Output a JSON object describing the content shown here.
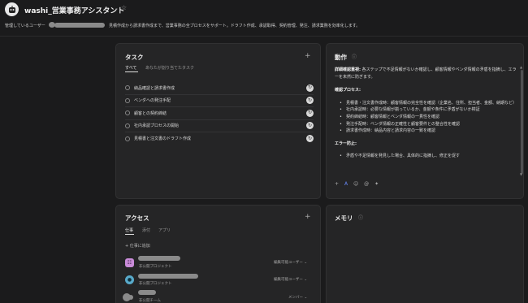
{
  "header": {
    "title": "washi_営業事務アシスタント",
    "chevron_icon": "chevron-down-icon",
    "star_icon": "star-icon",
    "managed_by_label": "管理しているユーザー",
    "description": "見積作成から請求書作成まで、営業事務の全プロセスをサポート。ドラフト作成、承認取得、契約管理、発注、請求業務を効率化します。"
  },
  "tasks": {
    "title": "タスク",
    "tabs": [
      "すべて",
      "あなたが割り当てたタスク"
    ],
    "items": [
      {
        "label": "納品確認と請求書作成"
      },
      {
        "label": "ベンダへの発注手配"
      },
      {
        "label": "顧客との契約締結"
      },
      {
        "label": "社内承認プロセスの開始"
      },
      {
        "label": "見積書と注文書のドラフト作成"
      }
    ],
    "item_action_icon": "run-icon"
  },
  "behavior": {
    "title": "動作",
    "intro_bold": "詳細確認重視:",
    "intro_text": " 各ステップで不足情報がないか確認し、顧客情報やベンダ情報の矛盾を指摘し、エラーを未然に防ぎます。",
    "checks_heading": "確認プロセス:",
    "checks": [
      "見積書・注文書作成時：顧客情報の完全性を確認（企業名、住所、担当者、金額、納期など）",
      "社内承認時：必要な情報が揃っているか、金額や条件に矛盾がないか検証",
      "契約締結時：顧客情報とベンダ情報の一貫性を確認",
      "発注手配時：ベンダ情報の正確性と顧客要件との整合性を確認",
      "請求書作成時：納品内容と請求内容の一致を確認"
    ],
    "error_heading": "エラー防止:",
    "errors": [
      "矛盾や不足情報を発見した場合、具体的に指摘し、修正を促す"
    ],
    "toolbar_icons": [
      "plus-icon",
      "format-icon",
      "emoji-icon",
      "mention-icon",
      "sparkle-icon"
    ]
  },
  "access": {
    "title": "アクセス",
    "tabs": [
      "仕事",
      "添付",
      "アプリ"
    ],
    "add_label": "仕事に追加",
    "entries": [
      {
        "sub": "非公開プロジェクト",
        "role": "編集可能ユーザー",
        "icon": "list-icon",
        "color": "#c98bd8"
      },
      {
        "sub": "非公開プロジェクト",
        "role": "編集可能ユーザー",
        "icon": "project-icon",
        "color": "#58a9c9"
      },
      {
        "sub": "非公開チーム",
        "role": "メンバー",
        "icon": "team-icon",
        "color": "#bdbdbd"
      }
    ]
  },
  "memory": {
    "title": "メモリ"
  }
}
